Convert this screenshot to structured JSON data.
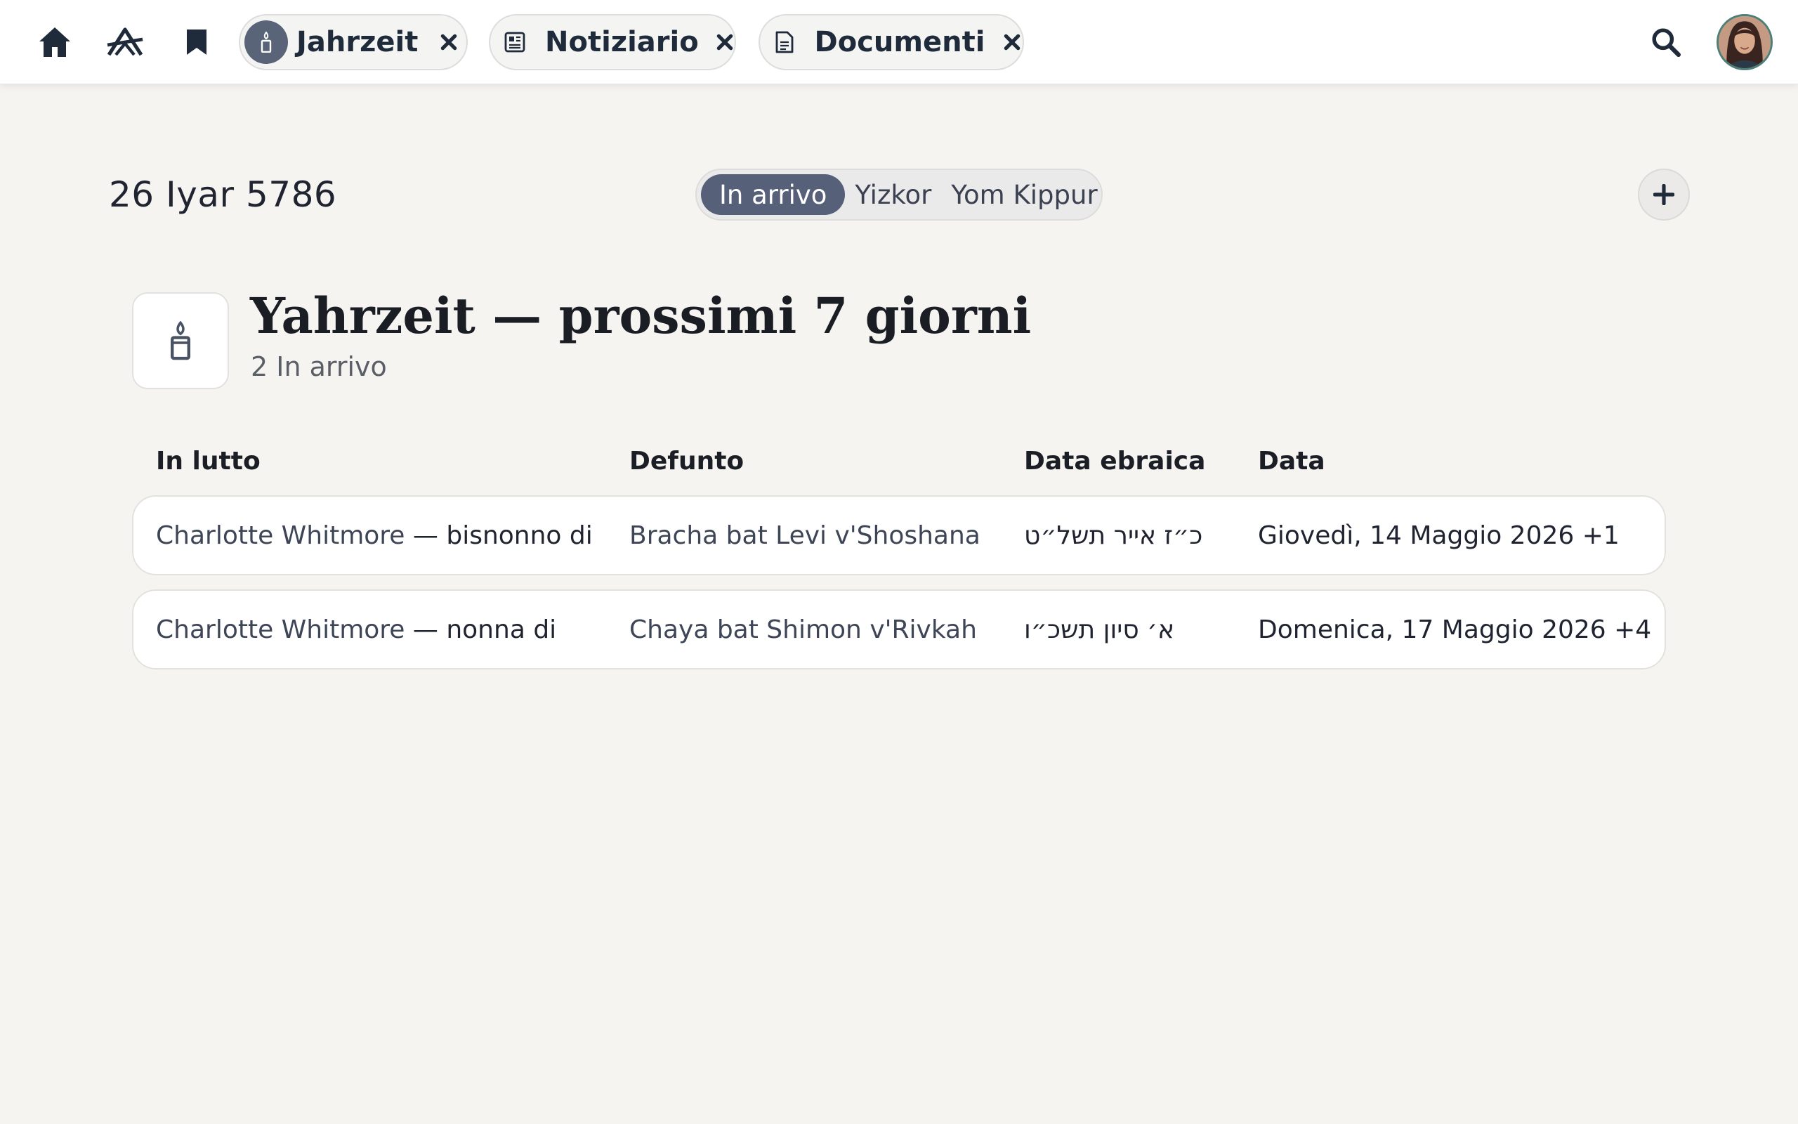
{
  "topbar": {
    "nav": [
      {
        "icon": "home-icon"
      },
      {
        "icon": "compass-icon"
      },
      {
        "icon": "bookmark-icon"
      }
    ],
    "tabs": [
      {
        "label": "Jahrzeit",
        "icon": "candle-icon"
      },
      {
        "label": "Notiziario",
        "icon": "newspaper-icon"
      },
      {
        "label": "Documenti",
        "icon": "document-icon"
      }
    ],
    "search_icon": "search-icon",
    "avatar": "user-avatar"
  },
  "header": {
    "hebrew_date": "26 Iyar 5786",
    "filters": [
      "In arrivo",
      "Yizkor",
      "Yom Kippur"
    ],
    "active_filter": "In arrivo"
  },
  "section": {
    "title": "Yahrzeit — prossimi 7 giorni",
    "subtitle": "2 In arrivo",
    "icon": "candle-icon"
  },
  "table": {
    "columns": [
      "In lutto",
      "Defunto",
      "Data ebraica",
      "Data"
    ],
    "rows": [
      {
        "mourner": "Charlotte Whitmore",
        "relation": " — bisnonno di",
        "deceased": "Bracha bat Levi v'Shoshana",
        "hebrew_date": "כ״ז אייר תשל״ט",
        "date": "Giovedì, 14 Maggio 2026 +1"
      },
      {
        "mourner": "Charlotte Whitmore",
        "relation": " — nonna di",
        "deceased": "Chaya bat Shimon v'Rivkah",
        "hebrew_date": "א׳ סיון תשכ״ו",
        "date": "Domenica, 17 Maggio 2026 +4"
      }
    ]
  },
  "colors": {
    "background": "#f6f4f1",
    "accent": "#566079",
    "text": "#1f2430"
  }
}
